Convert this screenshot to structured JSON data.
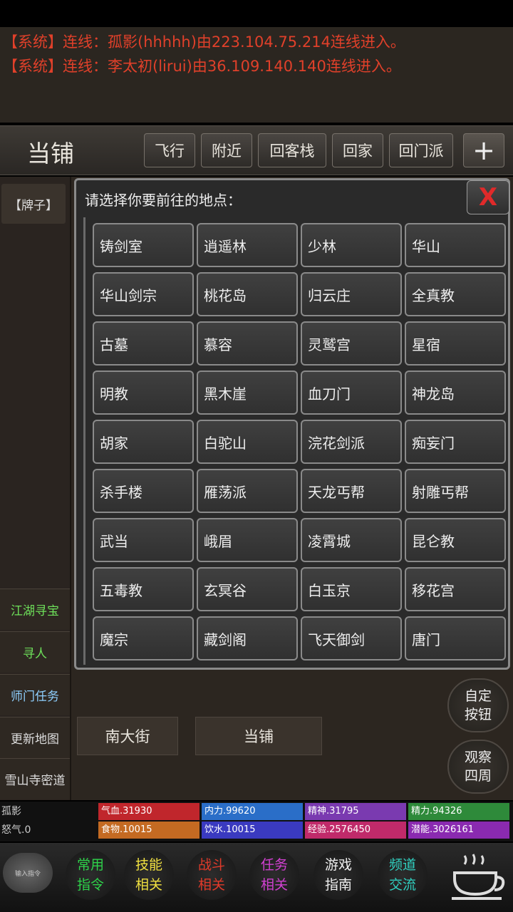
{
  "log": [
    "【系统】连线：孤影(hhhhh)由223.104.75.214连线进入。",
    "【系统】连线：李太初(lirui)由36.109.140.140连线进入。"
  ],
  "header": {
    "place": "当铺",
    "buttons": [
      "飞行",
      "附近",
      "回客栈",
      "回家",
      "回门派"
    ],
    "plus": "+"
  },
  "left": {
    "paizi": "【牌子】",
    "buttons": [
      "江湖寻宝",
      "寻人",
      "师门任务",
      "更新地图",
      "雪山寺密道"
    ]
  },
  "dialog": {
    "title": "请选择你要前往的地点：",
    "close": "X",
    "locations": [
      "铸剑室",
      "逍遥林",
      "少林",
      "华山",
      "华山剑宗",
      "桃花岛",
      "归云庄",
      "全真教",
      "古墓",
      "慕容",
      "灵鹫宫",
      "星宿",
      "明教",
      "黑木崖",
      "血刀门",
      "神龙岛",
      "胡家",
      "白驼山",
      "浣花剑派",
      "痴妄门",
      "杀手楼",
      "雁荡派",
      "天龙丐帮",
      "射雕丐帮",
      "武当",
      "峨眉",
      "凌霄城",
      "昆仑教",
      "五毒教",
      "玄冥谷",
      "白玉京",
      "移花宫",
      "魔宗",
      "藏剑阁",
      "飞天御剑",
      "唐门"
    ]
  },
  "exits": [
    "南大街",
    "当铺"
  ],
  "right_buttons": [
    {
      "l1": "自定",
      "l2": "按钮"
    },
    {
      "l1": "观察",
      "l2": "四周"
    }
  ],
  "stats": {
    "name": "孤影",
    "anger": "怒气.0",
    "bars": [
      {
        "label": "气血.31930",
        "color": "#c0262c"
      },
      {
        "label": "内力.99620",
        "color": "#2a6ec8"
      },
      {
        "label": "精神.31795",
        "color": "#7a3ab0"
      },
      {
        "label": "精力.94326",
        "color": "#2e8a3a"
      },
      {
        "label": "食物.10015",
        "color": "#c46a22"
      },
      {
        "label": "饮水.10015",
        "color": "#3a3ac0"
      },
      {
        "label": "经验.2576450",
        "color": "#c02a6a"
      },
      {
        "label": "潜能.3026161",
        "color": "#8a2ab0"
      }
    ]
  },
  "toolbar": {
    "input": "输入指令",
    "buttons": [
      {
        "l1": "常用",
        "l2": "指令",
        "color": "#2ed24a"
      },
      {
        "l1": "技能",
        "l2": "相关",
        "color": "#f0e040"
      },
      {
        "l1": "战斗",
        "l2": "相关",
        "color": "#e03a2a"
      },
      {
        "l1": "任务",
        "l2": "相关",
        "color": "#d040d0"
      },
      {
        "l1": "游戏",
        "l2": "指南",
        "color": "#f0f0f0"
      },
      {
        "l1": "频道",
        "l2": "交流",
        "color": "#30d0c0"
      }
    ]
  },
  "colors": {
    "left_btn": [
      "#6ee05a",
      "#6ee05a",
      "#ddd",
      "#ddd",
      "#ddd"
    ]
  }
}
